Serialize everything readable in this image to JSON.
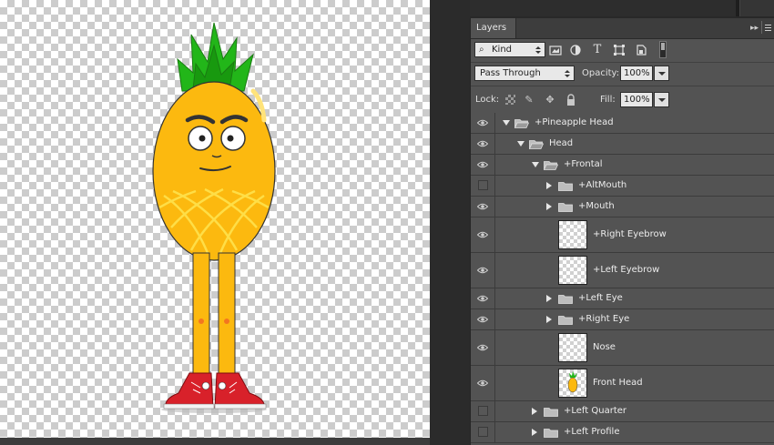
{
  "colors": {
    "panel_bg": "#535353",
    "pineapple_body": "#fcb90f",
    "pineapple_leaves": "#22b619",
    "shoes": "#d8212a"
  },
  "panel": {
    "tab_label": "Layers",
    "collapse_icon": "double-chevron-right-icon",
    "menu_icon": "panel-menu-icon",
    "filter": {
      "kind_label": "Kind",
      "icons": [
        "image-filter-icon",
        "adjustment-filter-icon",
        "type-filter-icon",
        "shape-filter-icon",
        "smart-object-filter-icon",
        "filter-toggle-icon"
      ]
    },
    "blend": {
      "mode": "Pass Through",
      "opacity_label": "Opacity:",
      "opacity_value": "100%"
    },
    "lock": {
      "label": "Lock:",
      "icons": [
        "lock-transparent-pixels-icon",
        "lock-image-pixels-icon",
        "lock-position-icon",
        "lock-all-icon"
      ],
      "fill_label": "Fill:",
      "fill_value": "100%"
    }
  },
  "layers": [
    {
      "name": "+Pineapple Head",
      "type": "group",
      "expanded": true,
      "visible": true
    },
    {
      "name": "Head",
      "type": "group",
      "expanded": true,
      "visible": true
    },
    {
      "name": "+Frontal",
      "type": "group",
      "expanded": true,
      "visible": true
    },
    {
      "name": "+AltMouth",
      "type": "group",
      "expanded": false,
      "visible": false
    },
    {
      "name": "+Mouth",
      "type": "group",
      "expanded": false,
      "visible": true
    },
    {
      "name": "+Right Eyebrow",
      "type": "layer",
      "visible": true,
      "thumb": "empty"
    },
    {
      "name": "+Left Eyebrow",
      "type": "layer",
      "visible": true,
      "thumb": "empty"
    },
    {
      "name": "+Left Eye",
      "type": "group",
      "expanded": false,
      "visible": true
    },
    {
      "name": "+Right Eye",
      "type": "group",
      "expanded": false,
      "visible": true
    },
    {
      "name": "Nose",
      "type": "layer",
      "visible": true,
      "thumb": "empty"
    },
    {
      "name": "Front Head",
      "type": "layer",
      "visible": true,
      "thumb": "pineapple"
    },
    {
      "name": "+Left Quarter",
      "type": "group",
      "expanded": false,
      "visible": false
    },
    {
      "name": "+Left Profile",
      "type": "group",
      "expanded": false,
      "visible": false
    }
  ]
}
